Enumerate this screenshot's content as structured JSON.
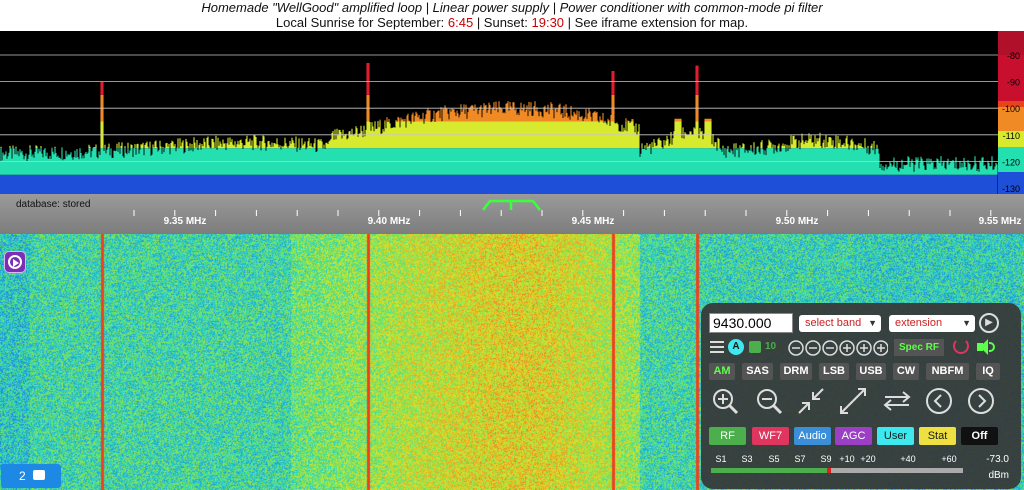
{
  "banner": {
    "line1": "Homemade \"WellGood\" amplified loop | Linear power supply | Power conditioner with common-mode pi filter",
    "line2_pre": "Local Sunrise for September: ",
    "sunrise": "6:45",
    "line2_mid": " | Sunset: ",
    "sunset": "19:30",
    "line2_post": " | See iframe extension for map."
  },
  "spectrum": {
    "db_labels": [
      "-80",
      "-90",
      "-100",
      "-110",
      "-120",
      "-130"
    ]
  },
  "scale": {
    "database_text": "database: stored",
    "freq_labels": [
      "9.35 MHz",
      "9.40 MHz",
      "9.45 MHz",
      "9.50 MHz",
      "9.55 MHz"
    ]
  },
  "chat": {
    "count": "2"
  },
  "panel": {
    "frequency": "9430.000",
    "band_select": "select band",
    "extension_select": "extension",
    "step_label": "10",
    "spec_label": "Spec RF",
    "modes": [
      "AM",
      "SAS",
      "DRM",
      "LSB",
      "USB",
      "CW",
      "NBFM",
      "IQ"
    ],
    "active_mode": "AM",
    "tabs": [
      {
        "label": "RF",
        "bg": "#4cae4c",
        "fg": "#ffffff"
      },
      {
        "label": "WF7",
        "bg": "#e0355f",
        "fg": "#ffffff"
      },
      {
        "label": "Audio",
        "bg": "#3a8fd8",
        "fg": "#ffffff"
      },
      {
        "label": "AGC",
        "bg": "#9b3fc4",
        "fg": "#ffffff"
      },
      {
        "label": "User",
        "bg": "#3ee8ef",
        "fg": "#1a1a1a"
      },
      {
        "label": "Stat",
        "bg": "#eee041",
        "fg": "#1a1a1a"
      },
      {
        "label": "Off",
        "bg": "#111111",
        "fg": "#ffffff"
      }
    ],
    "smeter": {
      "labels": [
        "S1",
        "S3",
        "S5",
        "S7",
        "S9",
        "+10",
        "+20",
        "+40",
        "+60"
      ],
      "value": "-73.0",
      "unit": "dBm"
    }
  },
  "colors": {
    "accent_green": "#5cff4c",
    "sunrise_red": "#cc0000"
  }
}
